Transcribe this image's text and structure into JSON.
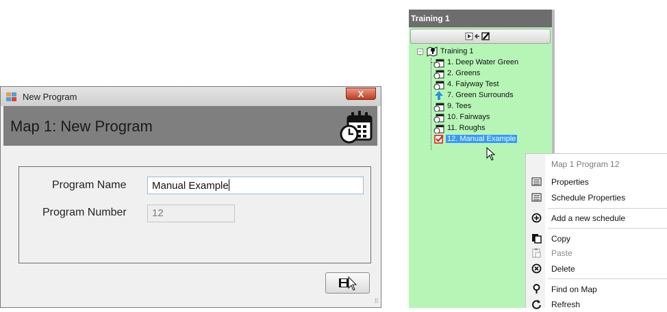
{
  "dialog": {
    "window_title": "New Program",
    "close_label": "X",
    "header_title": "Map 1: New Program",
    "fields": {
      "program_name_label": "Program Name",
      "program_name_value": "Manual Example",
      "program_number_label": "Program Number",
      "program_number_value": "12"
    },
    "resize_grip": "⠿"
  },
  "tree_panel": {
    "header": "Training 1",
    "root": "Training 1",
    "items": [
      {
        "label": "1. Deep Water Green",
        "icon": "calendar-clock-icon"
      },
      {
        "label": "2. Greens",
        "icon": "calendar-clock-icon"
      },
      {
        "label": "4. Faiyway Test",
        "icon": "calendar-clock-icon"
      },
      {
        "label": "7. Green Surrounds",
        "icon": "up-arrow-icon"
      },
      {
        "label": "9. Tees",
        "icon": "calendar-clock-icon"
      },
      {
        "label": "10. Fairways",
        "icon": "calendar-clock-icon"
      },
      {
        "label": "11. Roughs",
        "icon": "calendar-clock-icon"
      },
      {
        "label": "12. Manual Example",
        "icon": "checked-box-icon",
        "selected": true
      }
    ]
  },
  "context_menu": {
    "title": "Map 1 Program 12",
    "items": [
      {
        "label": "Properties",
        "icon": "list-icon"
      },
      {
        "label": "Schedule Properties",
        "icon": "list-icon"
      },
      {
        "label": "Add a new schedule",
        "icon": "plus-circle-icon"
      },
      {
        "label": "Copy",
        "icon": "copy-icon"
      },
      {
        "label": "Paste",
        "icon": "paste-icon",
        "disabled": true
      },
      {
        "label": "Delete",
        "icon": "delete-circle-icon"
      },
      {
        "label": "Find on Map",
        "icon": "map-pin-icon"
      },
      {
        "label": "Refresh",
        "icon": "refresh-icon"
      }
    ]
  },
  "colors": {
    "tree_background": "#b6f5b6",
    "header_gray": "#7f7f7f",
    "selection_blue": "#3399ff",
    "close_red": "#c23b1f"
  }
}
